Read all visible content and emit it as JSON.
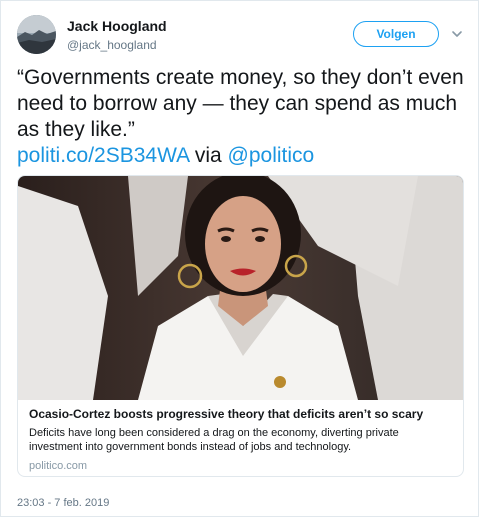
{
  "author": {
    "name": "Jack Hoogland",
    "handle": "@jack_hoogland"
  },
  "follow_label": "Volgen",
  "tweet": {
    "quote": "“Governments create money, so they don’t even need to borrow any — they can spend as much as they like.”",
    "link_text": "politi.co/2SB34WA",
    "via_text": "via",
    "mention": "@politico"
  },
  "card": {
    "title": "Ocasio-Cortez boosts progressive theory that deficits aren’t so scary",
    "description": "Deficits have long been considered a drag on the economy, diverting private investment into government bonds instead of jobs and technology.",
    "domain": "politico.com"
  },
  "timestamp": "23:03 - 7 feb. 2019",
  "colors": {
    "link": "#1b95e0",
    "follow_accent": "#1da1f2"
  }
}
